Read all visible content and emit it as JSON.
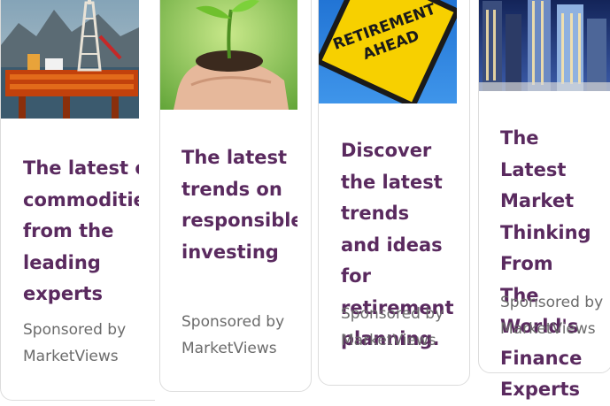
{
  "cards": [
    {
      "headline": [
        "The latest o",
        "commoditie",
        "from the",
        "leading",
        "experts"
      ],
      "sponsor": [
        "Sponsored by",
        "MarketViews"
      ],
      "image_icon": "oil-rig-image"
    },
    {
      "headline": [
        "The latest",
        "trends on",
        "responsible",
        "investing"
      ],
      "sponsor": [
        "Sponsored by",
        "MarketViews"
      ],
      "image_icon": "seedling-hands-image"
    },
    {
      "headline": [
        "Discover",
        "the latest",
        "trends",
        "and ideas",
        "for",
        "retirement",
        "planning."
      ],
      "sponsor": [
        "Sponsored by",
        "MarketViews"
      ],
      "sign_text": [
        "RETIREMENT",
        "AHEAD"
      ],
      "image_icon": "retirement-sign-image"
    },
    {
      "headline": [
        "The",
        "Latest",
        "Market",
        "Thinking",
        "From",
        "The",
        "World's",
        "Finance",
        "Experts"
      ],
      "sponsor": [
        "Sponsored by",
        "MarketViews"
      ],
      "image_icon": "skyscrapers-image"
    }
  ],
  "colors": {
    "headline": "#5a2a5f",
    "sponsor": "#6b6b6b",
    "border": "#dcdcdc"
  }
}
